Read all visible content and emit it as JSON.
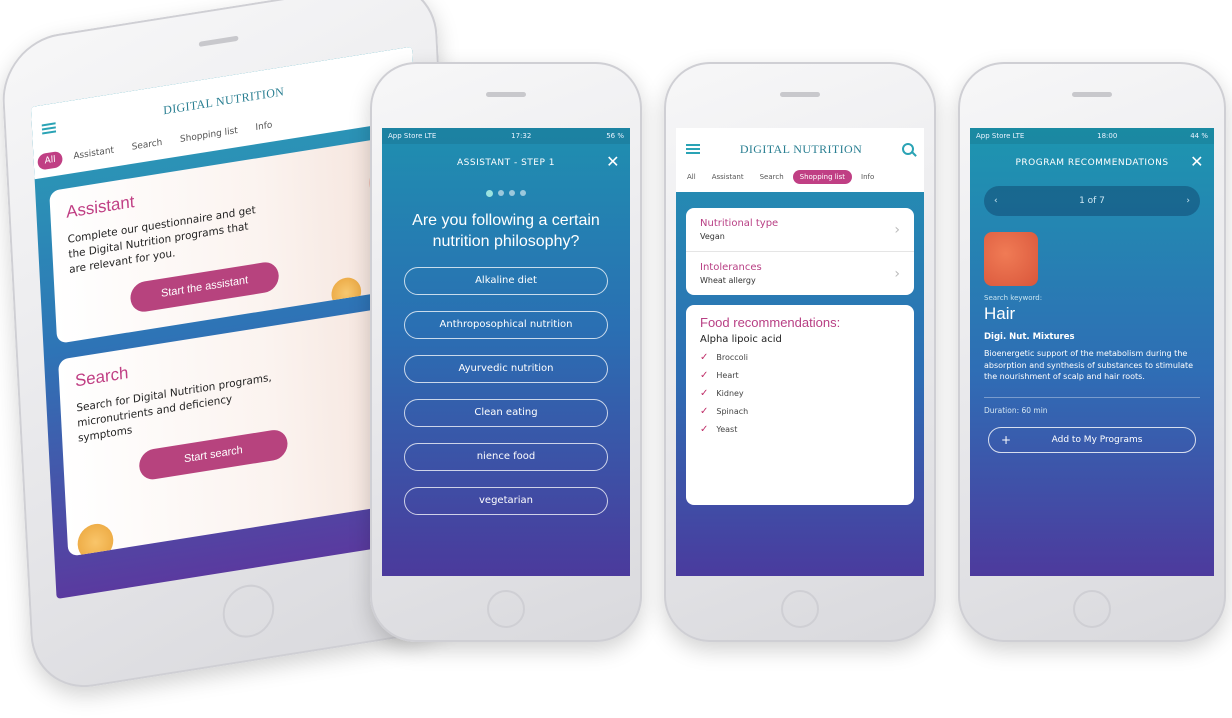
{
  "app_title": "DIGITAL NUTRITION",
  "tabs": [
    "All",
    "Assistant",
    "Search",
    "Shopping list",
    "Info"
  ],
  "phone1": {
    "assistant_card": {
      "title": "Assistant",
      "text": "Complete our questionnaire and get the Digital Nutrition programs that are relevant for you.",
      "button": "Start the assistant"
    },
    "search_card": {
      "title": "Search",
      "text": "Search for Digital Nutrition programs, micronutrients and deficiency symptoms",
      "button": "Start search"
    }
  },
  "phone2": {
    "status": {
      "left": "App Store  LTE",
      "time": "17:32",
      "battery": "56 %"
    },
    "title": "ASSISTANT - STEP 1",
    "question": "Are you following a certain nutrition philosophy?",
    "options": [
      "Alkaline diet",
      "Anthroposophical nutrition",
      "Ayurvedic nutrition",
      "Clean eating",
      "nience food",
      "vegetarian"
    ]
  },
  "phone3": {
    "nutritional_type": {
      "label": "Nutritional type",
      "value": "Vegan"
    },
    "intolerances": {
      "label": "Intolerances",
      "value": "Wheat allergy"
    },
    "food": {
      "title": "Food recommendations:",
      "subtitle": "Alpha lipoic acid",
      "items": [
        "Broccoli",
        "Heart",
        "Kidney",
        "Spinach",
        "Yeast"
      ]
    }
  },
  "phone4": {
    "status": {
      "left": "App Store  LTE",
      "time": "18:00",
      "battery": "44 %"
    },
    "title": "PROGRAM RECOMMENDATIONS",
    "pager": "1 of 7",
    "search_keyword_label": "Search keyword:",
    "keyword": "Hair",
    "mixture": "Digi. Nut. Mixtures",
    "description": "Bioenergetic support of the metabolism during the absorption and synthesis of substances to stimulate the nourishment of scalp and hair roots.",
    "duration": "Duration: 60 min",
    "add_button": "Add to My Programs"
  },
  "colors": {
    "accent": "#c03f84",
    "teal": "#2aa3b5",
    "gradient_top": "#1f8fb0",
    "gradient_bottom": "#4b3a9c"
  }
}
